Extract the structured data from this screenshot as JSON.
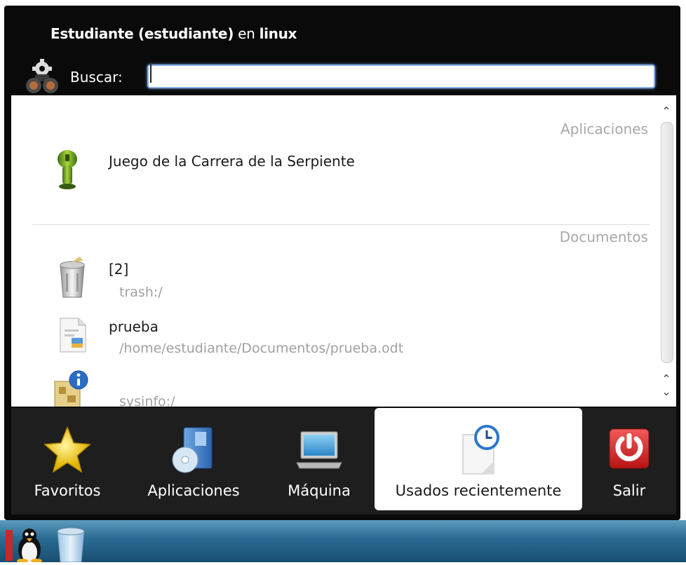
{
  "header": {
    "user_bold": "Estudiante (estudiante)",
    "connector": "en",
    "host": "linux"
  },
  "search": {
    "label": "Buscar:",
    "value": ""
  },
  "results": {
    "sections": [
      {
        "title": "Aplicaciones",
        "items": [
          {
            "title": "Juego de la Carrera de la Serpiente",
            "icon": "snake-game-icon"
          }
        ]
      },
      {
        "title": "Documentos",
        "items": [
          {
            "title": "[2]",
            "subtitle": "trash:/",
            "icon": "trash-icon"
          },
          {
            "title": "prueba",
            "subtitle": "/home/estudiante/Documentos/prueba.odt",
            "icon": "document-icon"
          },
          {
            "title": "",
            "subtitle": "sysinfo:/",
            "icon": "sysinfo-icon"
          }
        ]
      }
    ]
  },
  "tabs": [
    {
      "label": "Favoritos",
      "icon": "star-icon",
      "active": false
    },
    {
      "label": "Aplicaciones",
      "icon": "applications-icon",
      "active": false
    },
    {
      "label": "Máquina",
      "icon": "laptop-icon",
      "active": false
    },
    {
      "label": "Usados recientemente",
      "icon": "recent-clock-icon",
      "active": true
    },
    {
      "label": "Salir",
      "icon": "power-icon",
      "active": false
    }
  ],
  "colors": {
    "window_bg": "#0a0a0a",
    "tab_bar_bg": "#1e1e1e",
    "search_focus": "#86b2e6",
    "section_title": "#a8a8a8",
    "subtitle": "#a0a0a0",
    "power_red": "#d42424",
    "taskbar_blue": "#2a6a92"
  }
}
